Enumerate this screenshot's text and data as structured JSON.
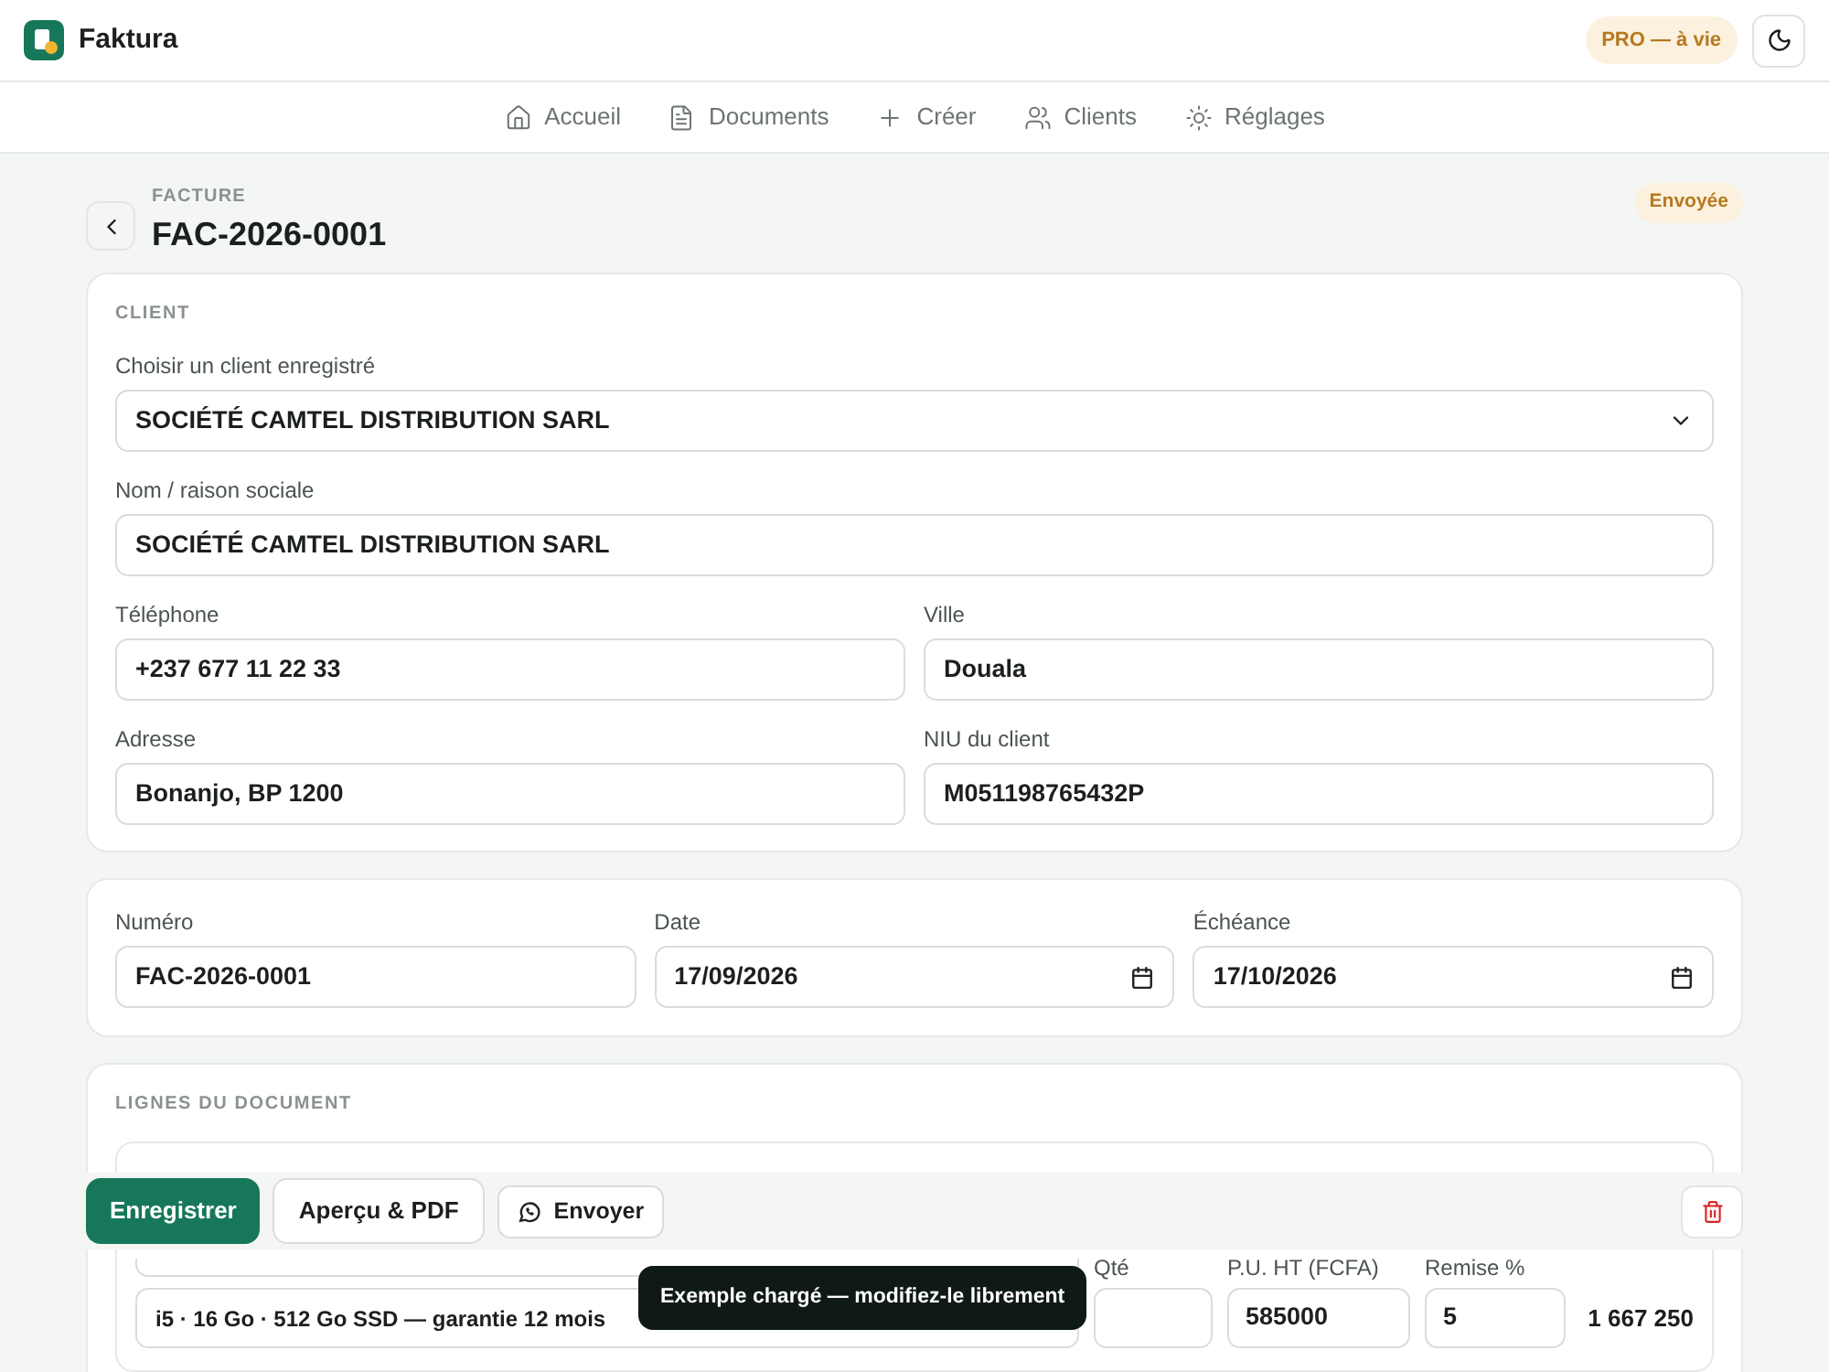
{
  "header": {
    "app_name": "Faktura",
    "plan_badge": "PRO — à vie"
  },
  "nav": [
    {
      "label": "Accueil",
      "selected": false
    },
    {
      "label": "Documents",
      "selected": false
    },
    {
      "label": "Créer",
      "selected": false
    },
    {
      "label": "Clients",
      "selected": false
    },
    {
      "label": "Réglages",
      "selected": false
    }
  ],
  "document": {
    "type_label": "FACTURE",
    "number": "FAC-2026-0001",
    "status": "Envoyée"
  },
  "client": {
    "heading": "CLIENT",
    "select": {
      "label": "Choisir un client enregistré",
      "value": "SOCIÉTÉ CAMTEL DISTRIBUTION SARL"
    },
    "name": {
      "label": "Nom / raison sociale",
      "value": "SOCIÉTÉ CAMTEL DISTRIBUTION SARL"
    },
    "fields": [
      {
        "label": "Téléphone",
        "value": "+237 677 11 22 33"
      },
      {
        "label": "Ville",
        "value": "Douala"
      },
      {
        "label": "Adresse",
        "value": "Bonanjo, BP 1200"
      },
      {
        "label": "NIU du client",
        "value": "M051198765432P"
      }
    ]
  },
  "meta": [
    {
      "label": "Numéro",
      "value": "FAC-2026-0001",
      "kind": "text"
    },
    {
      "label": "Date",
      "value": "17/09/2026",
      "kind": "date"
    },
    {
      "label": "Échéance",
      "value": "17/10/2026",
      "kind": "date"
    }
  ],
  "lines": {
    "heading": "LIGNES DU DOCUMENT",
    "columns": [
      "Qté",
      "P.U. HT (FCFA)",
      "Remise %"
    ],
    "items": [
      {
        "description": "i5 · 16 Go · 512 Go SSD — garantie 12 mois",
        "price": "585000",
        "discount": "5",
        "total": "1 667 250"
      }
    ]
  },
  "actions": [
    {
      "label": "Enregistrer",
      "kind": "primary"
    },
    {
      "label": "Aperçu & PDF",
      "kind": "secondary"
    },
    {
      "label": "Envoyer",
      "kind": "whatsapp"
    }
  ],
  "toast": "Exemple chargé — modifiez-le librement"
}
